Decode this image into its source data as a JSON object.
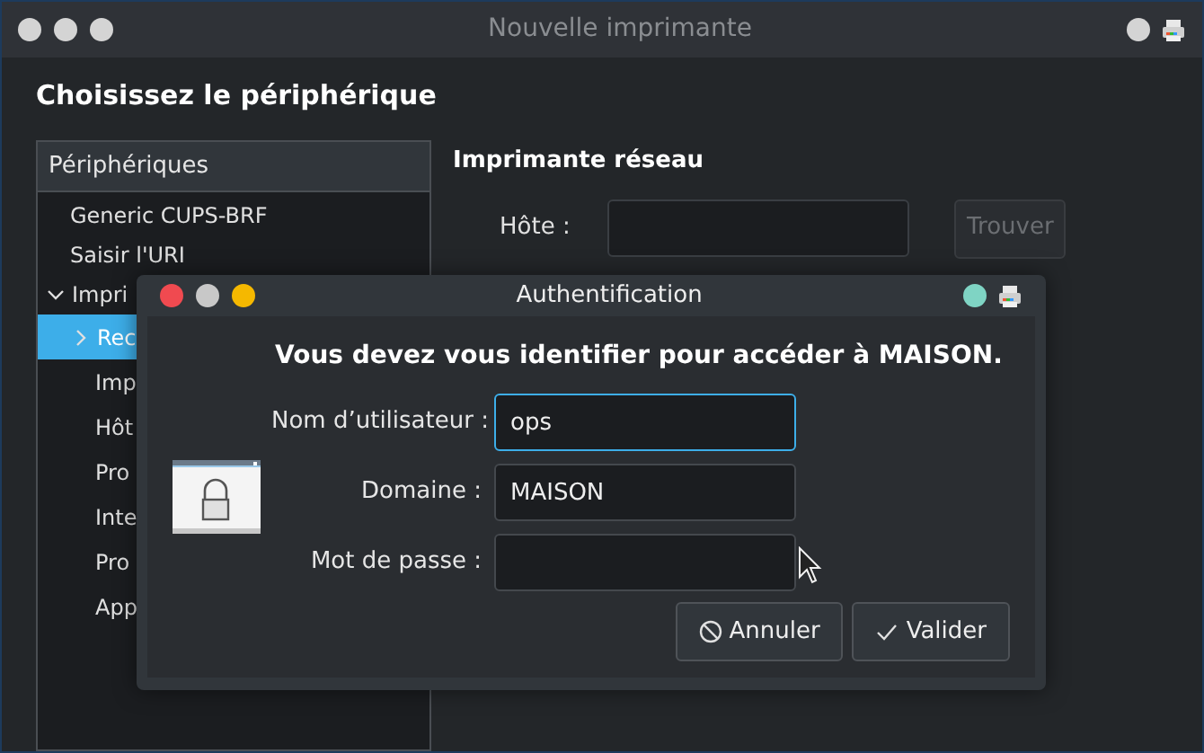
{
  "window": {
    "title": "Nouvelle imprimante",
    "active": false,
    "heading": "Choisissez le périphérique"
  },
  "devices": {
    "header": "Périphériques",
    "items": [
      {
        "label": "Generic CUPS-BRF",
        "selected": false
      },
      {
        "label": "Saisir l'URI",
        "selected": false
      },
      {
        "label": "Impri",
        "selected": false,
        "expanded": true,
        "children": [
          {
            "label": "Rec",
            "selected": true,
            "expanded": false
          },
          {
            "label": "Imp",
            "selected": false
          },
          {
            "label": "Hôt",
            "selected": false
          },
          {
            "label": "Pro",
            "selected": false
          },
          {
            "label": "Inte",
            "selected": false
          },
          {
            "label": "Pro",
            "selected": false
          },
          {
            "label": "App",
            "selected": false
          }
        ]
      }
    ]
  },
  "network": {
    "title": "Imprimante réseau",
    "host_label": "Hôte :",
    "find_button": {
      "label": "Trouver",
      "disabled": true
    }
  },
  "dialog": {
    "title": "Authentification",
    "active": true,
    "message": "Vous devez vous identifier pour accéder à MAISON.",
    "fields": [
      {
        "label": "Nom d’utilisateur :",
        "value": "ops",
        "focused": true
      },
      {
        "label": "Domaine :",
        "value": "MAISON",
        "focused": false
      },
      {
        "label": "Mot de passe :",
        "focused": false
      }
    ],
    "buttons": [
      {
        "kind": "cancel",
        "label": "Annuler"
      },
      {
        "kind": "confirm",
        "label": "Valider"
      }
    ]
  }
}
